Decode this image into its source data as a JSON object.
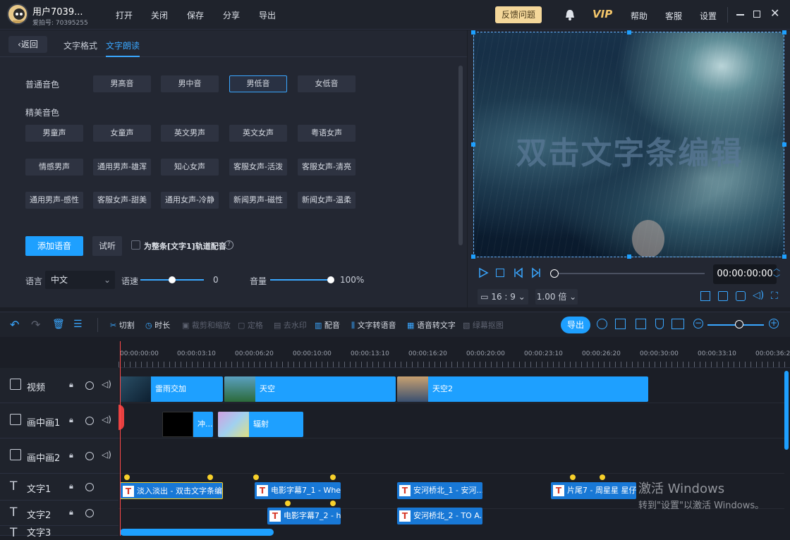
{
  "app": {
    "user_name": "用户7039...",
    "user_id": "爱拍号: 70395255",
    "menu": [
      "打开",
      "关闭",
      "保存",
      "分享",
      "导出"
    ],
    "feedback": "反馈问题",
    "vip": "VIP",
    "right_menu": [
      "帮助",
      "客服",
      "设置"
    ]
  },
  "panel": {
    "back": "返回",
    "tabs": [
      "文字格式",
      "文字朗读"
    ],
    "normal_voice_label": "普通音色",
    "normal_voices": [
      "男高音",
      "男中音",
      "男低音",
      "女低音"
    ],
    "selected_voice": "男低音",
    "premium_voice_label": "精美音色",
    "premium_voices": [
      "男童声",
      "女童声",
      "英文男声",
      "英文女声",
      "粤语女声",
      "情感男声",
      "通用男声-雄浑",
      "知心女声",
      "客服女声-活泼",
      "客服女声-清亮",
      "通用男声-感性",
      "客服女声-甜美",
      "通用女声-冷静",
      "新闻男声-磁性",
      "新闻女声-温柔"
    ],
    "add_voice": "添加语音",
    "listen": "试听",
    "whole_track": "为整条[文字1]轨道配音",
    "lang_label": "语言",
    "lang_value": "中文",
    "speed_label": "语速",
    "speed_value": "0",
    "volume_label": "音量",
    "volume_value": "100%"
  },
  "preview": {
    "overlay_text": "双击文字条编辑",
    "time": "00:00:00:00",
    "ratio": "16 : 9",
    "speed": "1.00 倍"
  },
  "toolbar": {
    "tools": [
      "切割",
      "时长",
      "裁剪和缩放",
      "定格",
      "去水印",
      "配音",
      "文字转语音",
      "语音转文字",
      "绿幕抠图"
    ],
    "export": "导出"
  },
  "ruler": [
    "00:00:00:00",
    "00:00:03:10",
    "00:00:06:20",
    "00:00:10:00",
    "00:00:13:10",
    "00:00:16:20",
    "00:00:20:00",
    "00:00:23:10",
    "00:00:26:20",
    "00:00:30:00",
    "00:00:33:10",
    "00:00:36:20"
  ],
  "tracks": {
    "labels": [
      "视频",
      "画中画1",
      "画中画2",
      "文字1",
      "文字2",
      "文字3"
    ],
    "video_clips": [
      "雷雨交加",
      "天空",
      "天空2"
    ],
    "pip_clips": [
      "冲...",
      "辐射"
    ],
    "text1_clips": [
      "淡入淡出 - 双击文字条编辑",
      "电影字幕7_1 - Whe...",
      "安河桥北_1 - 安河...",
      "片尾7 - 周星星 星仔..."
    ],
    "text2_clips": [
      "电影字幕7_2 - h...",
      "安河桥北_2 - TO A..."
    ]
  },
  "watermark": {
    "line1": "激活 Windows",
    "line2": "转到\"设置\"以激活 Windows。"
  },
  "colors": {
    "accent": "#1ea0ff",
    "feedback_bg": "#f4d79a",
    "vip": "#f3c56a",
    "playhead": "#ff4a4a"
  }
}
